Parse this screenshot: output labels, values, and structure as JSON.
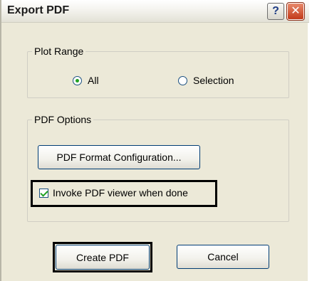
{
  "window": {
    "title": "Export PDF",
    "help_glyph": "?",
    "close_glyph": "✕"
  },
  "plot_range": {
    "legend": "Plot Range",
    "options": [
      {
        "label": "All",
        "selected": true
      },
      {
        "label": "Selection",
        "selected": false
      }
    ]
  },
  "pdf_options": {
    "legend": "PDF Options",
    "format_button_label": "PDF Format Configuration...",
    "invoke_viewer_label": "Invoke PDF viewer when done",
    "invoke_viewer_checked": true
  },
  "actions": {
    "create_label": "Create PDF",
    "cancel_label": "Cancel"
  },
  "icons": {
    "help": "help-icon",
    "close": "close-icon"
  },
  "colors": {
    "dialog_bg": "#ece9d8",
    "button_border": "#003c74",
    "check_green": "#21a121",
    "close_red": "#c23a1a"
  }
}
